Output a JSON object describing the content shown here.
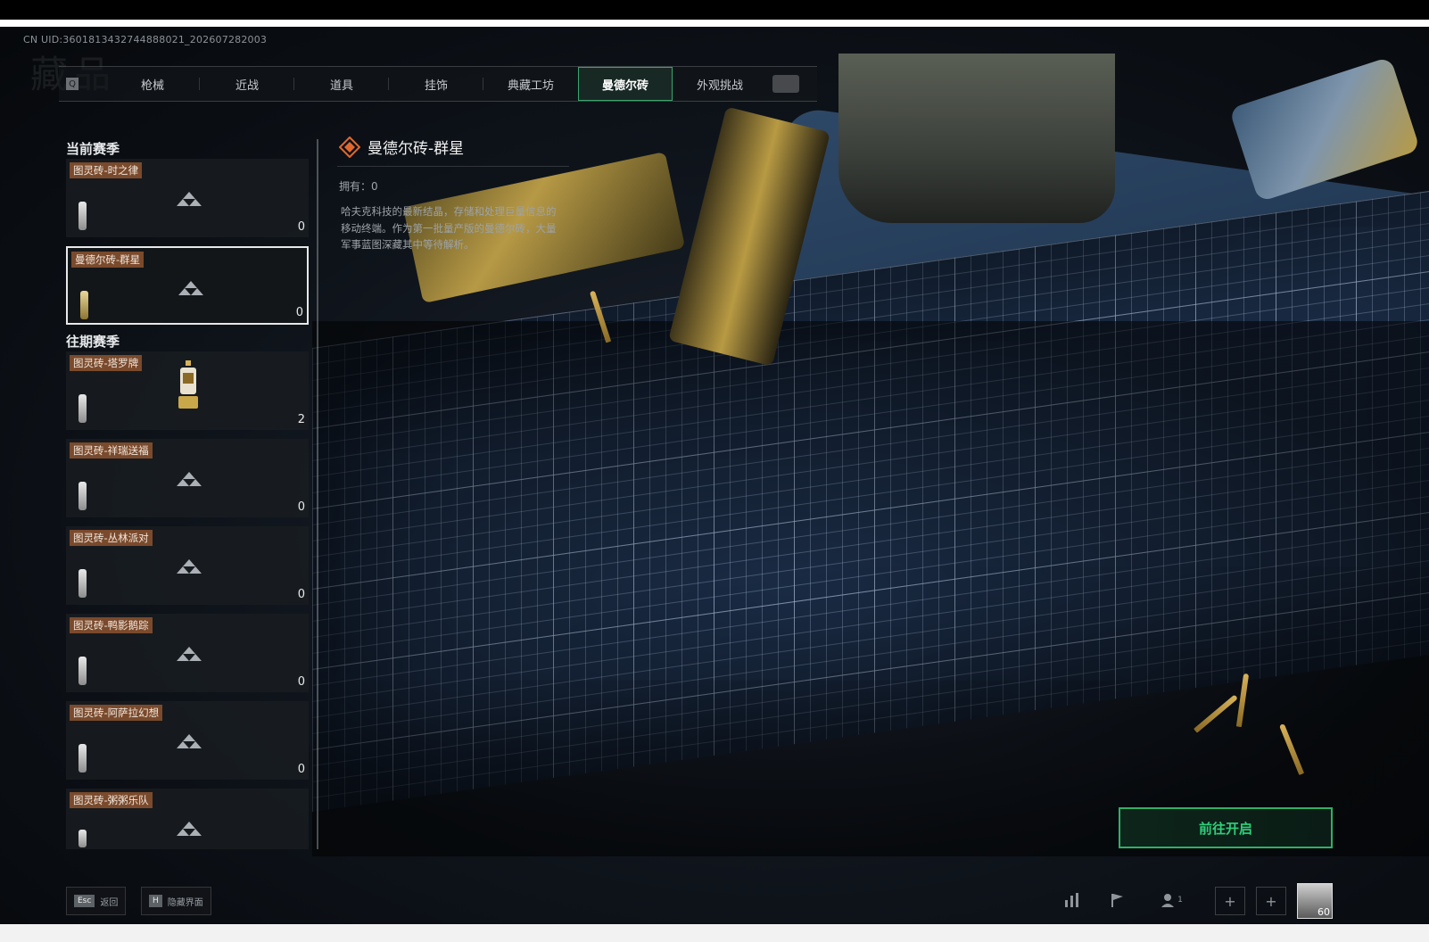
{
  "header": {
    "uid_text": "CN UID:3601813432744888021_202607282003",
    "page_title": "藏品"
  },
  "tabs": {
    "key_hint": "Q",
    "items": [
      {
        "label": "枪械",
        "active": false
      },
      {
        "label": "近战",
        "active": false
      },
      {
        "label": "道具",
        "active": false
      },
      {
        "label": "挂饰",
        "active": false
      },
      {
        "label": "典藏工坊",
        "active": false
      },
      {
        "label": "曼德尔砖",
        "active": true
      },
      {
        "label": "外观挑战",
        "active": false
      }
    ],
    "extra_icon": "trophy-icon"
  },
  "current_season": {
    "title": "当前赛季",
    "cards": [
      {
        "label": "图灵砖-时之律",
        "count": "0",
        "selected": false
      },
      {
        "label": "曼德尔砖-群星",
        "count": "0",
        "selected": true
      }
    ]
  },
  "past_seasons": {
    "title": "往期赛季",
    "cards": [
      {
        "label": "图灵砖-塔罗牌",
        "count": "2",
        "has_figure": true
      },
      {
        "label": "图灵砖-祥瑞送福",
        "count": "0"
      },
      {
        "label": "图灵砖-丛林派对",
        "count": "0"
      },
      {
        "label": "图灵砖-鸭影鹅踪",
        "count": "0"
      },
      {
        "label": "图灵砖-阿萨拉幻想",
        "count": "0"
      },
      {
        "label": "图灵砖-粥粥乐队",
        "count": ""
      }
    ]
  },
  "detail": {
    "title": "曼德尔砖-群星",
    "owned": "拥有：0",
    "description": "哈夫克科技的最新结晶，存储和处理巨量信息的移动终端。作为第一批量产版的曼德尔砖，大量军事蓝图深藏其中等待解析。"
  },
  "action": {
    "open_button": "前往开启"
  },
  "footer": {
    "hints": [
      {
        "key": "Esc",
        "label": "返回"
      },
      {
        "key": "H",
        "label": "隐藏界面"
      }
    ],
    "friend_count": "1",
    "avatar_level": "60"
  },
  "colors": {
    "accent_green": "#2fb067",
    "label_brown": "#7a4a2c",
    "diamond_orange": "#e0682e"
  }
}
